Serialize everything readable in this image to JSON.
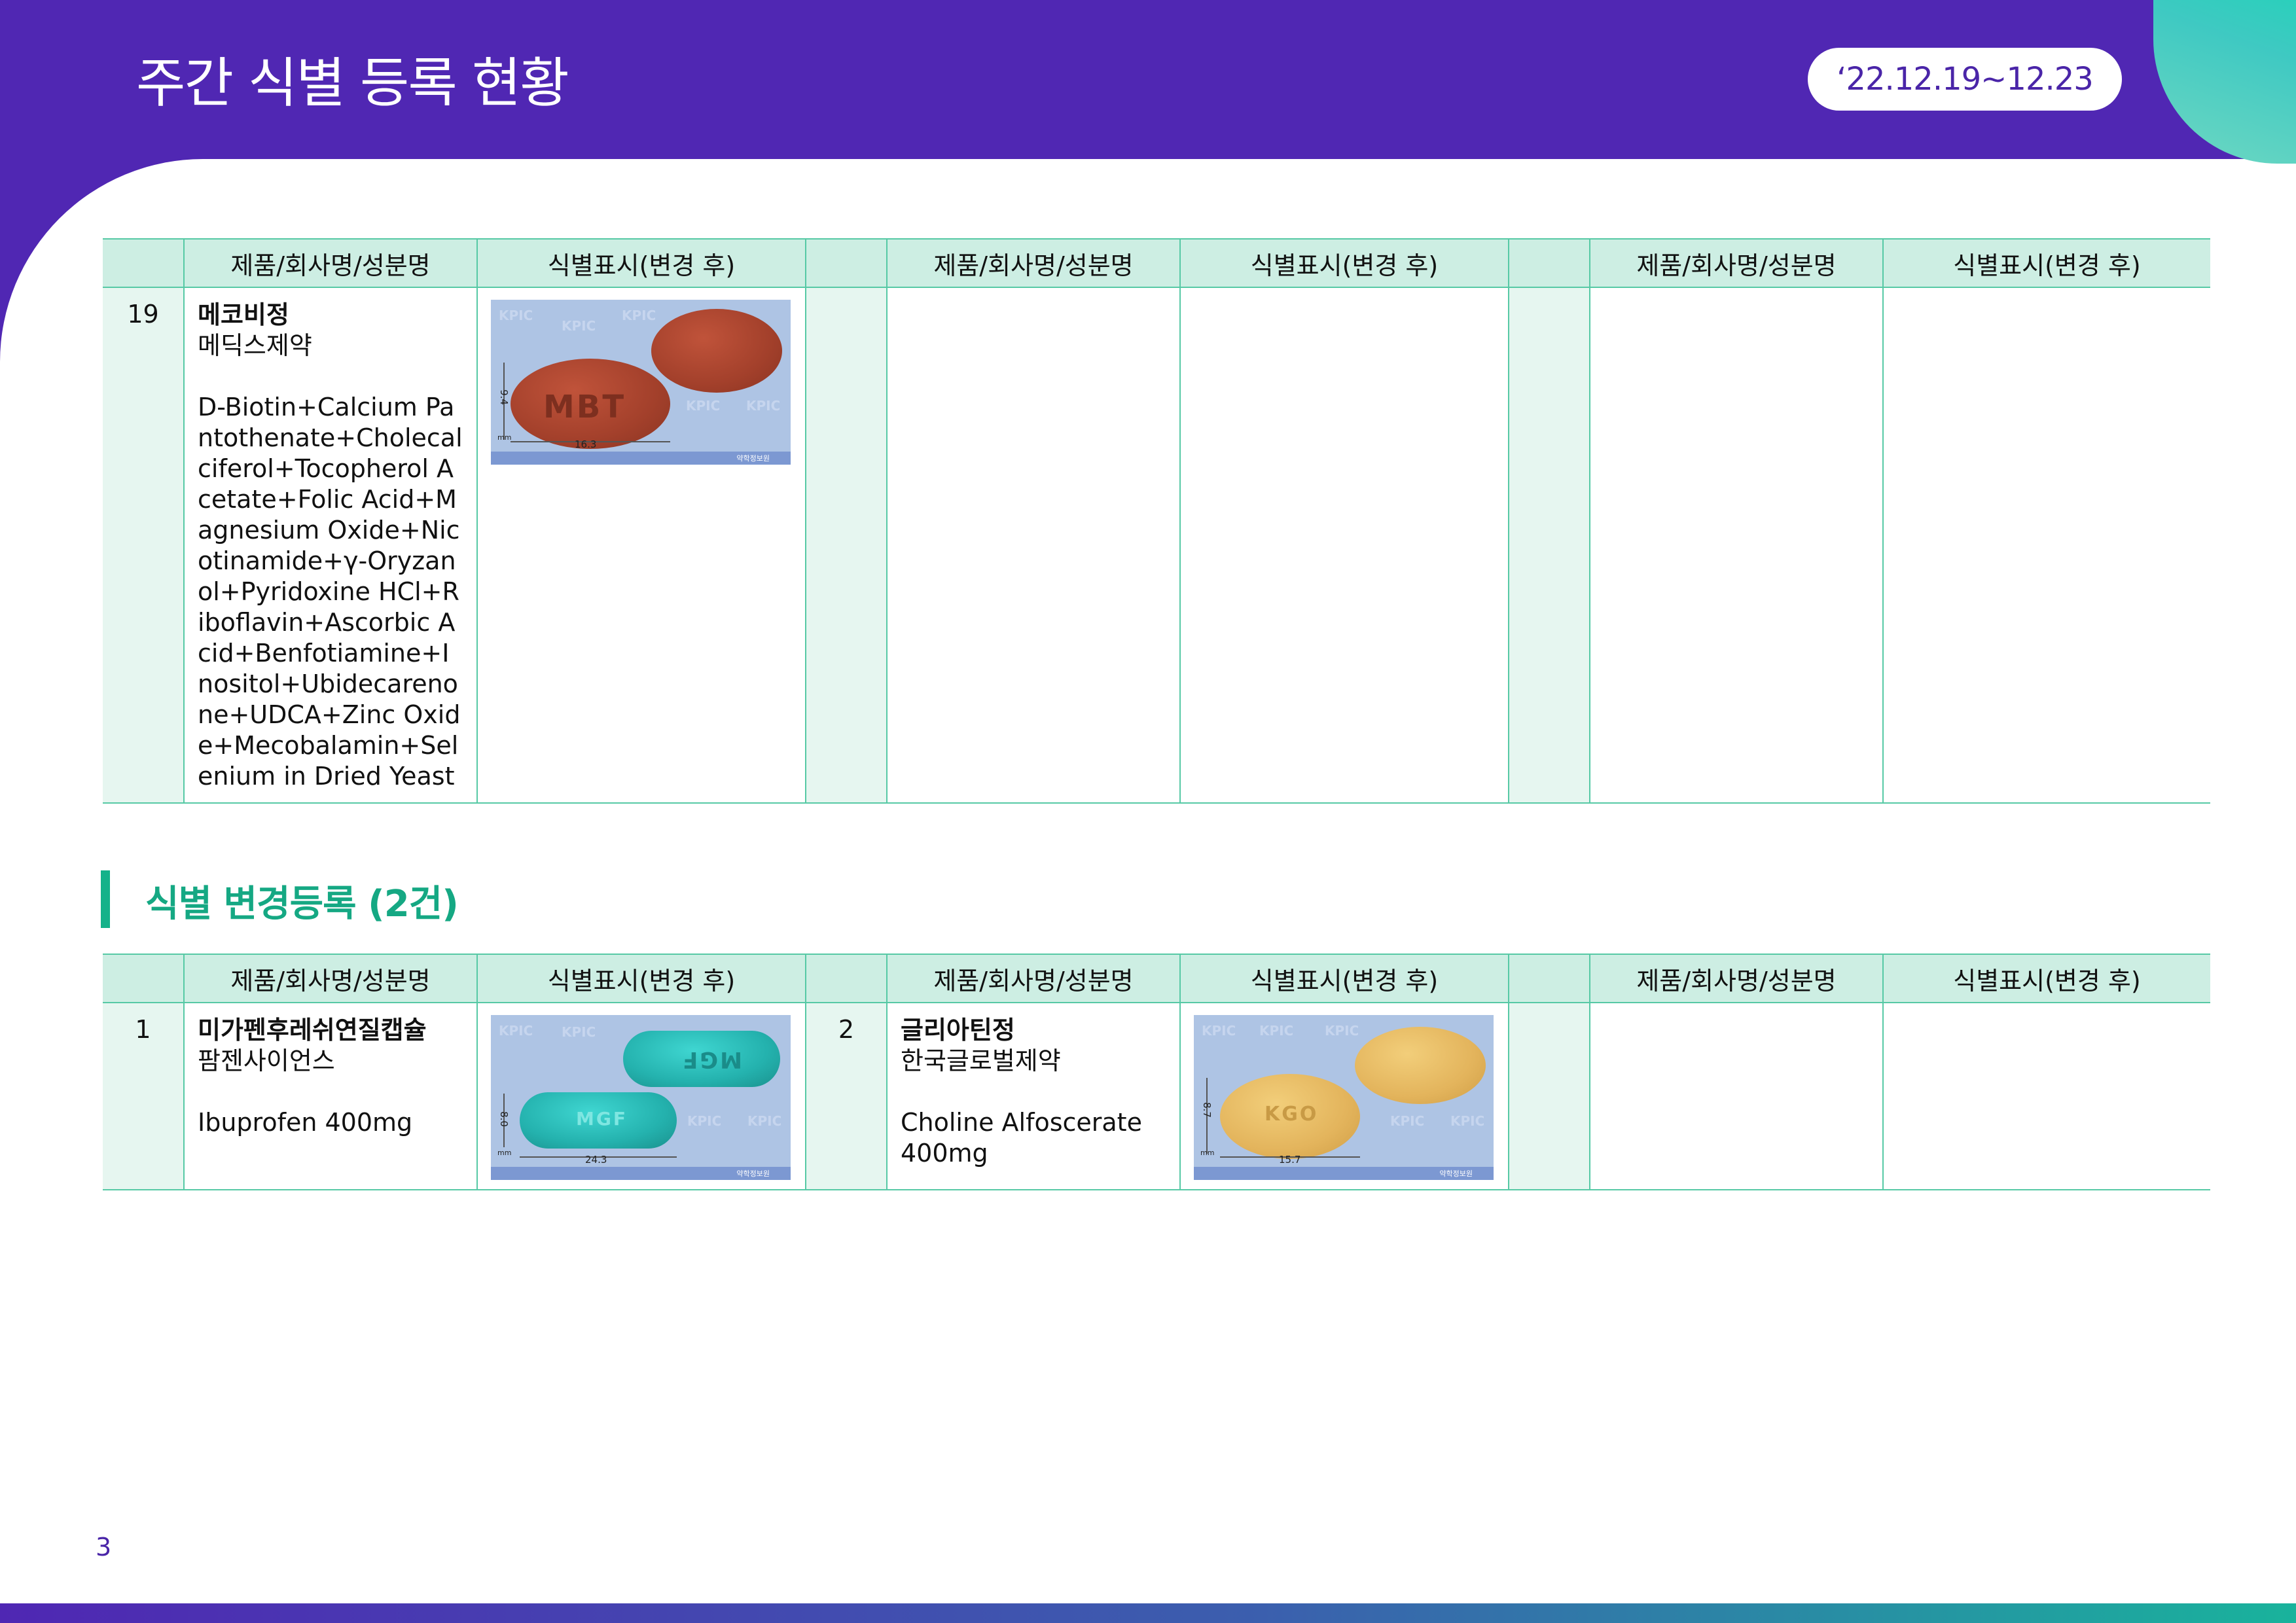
{
  "header": {
    "title": "주간 식별 등록 현황",
    "date_range": "‘22.12.19~12.23"
  },
  "table_headers": {
    "product": "제품/회사명/성분명",
    "mark": "식별표시(변경 후)"
  },
  "table1": {
    "rows": [
      {
        "no": "19",
        "name": "메코비정",
        "company": "메딕스제약",
        "ingredient": "D-Biotin+Calcium Pantothenate+Cholecalciferol+Tocopherol Acetate+Folic Acid+Magnesium Oxide+Nicotinamide+γ-Oryzanol+Pyridoxine HCl+Riboflavin+Ascorbic Acid+Benfotiamine+Inositol+Ubidecarenone+UDCA+Zinc Oxide+Mecobalamin+Selenium in Dried Yeast",
        "photo": {
          "imprint": "MBT",
          "dim_h": "9.4",
          "dim_w": "16.3",
          "unit": "mm",
          "watermark": "KPIC",
          "strip": "약학정보원",
          "color": "#a3402b"
        }
      }
    ]
  },
  "section": {
    "title": "식별 변경등록 (2건)"
  },
  "table2": {
    "rows": [
      {
        "no": "1",
        "name": "미가펜후레쉬연질캡슐",
        "company": "팜젠사이언스",
        "ingredient": "Ibuprofen 400mg",
        "photo": {
          "imprint": "MGF",
          "dim_h": "8.0",
          "dim_w": "24.3",
          "unit": "mm",
          "watermark": "KPIC",
          "strip": "약학정보원",
          "color": "#24b2ae"
        }
      },
      {
        "no": "2",
        "name": "글리아틴정",
        "company": "한국글로벌제약",
        "ingredient": "Choline Alfoscerate 400mg",
        "photo": {
          "imprint": "KGO",
          "dim_h": "8.7",
          "dim_w": "15.7",
          "unit": "mm",
          "watermark": "KPIC",
          "strip": "약학정보원",
          "color": "#e3b45c"
        }
      }
    ]
  },
  "footer": {
    "page": "3"
  }
}
